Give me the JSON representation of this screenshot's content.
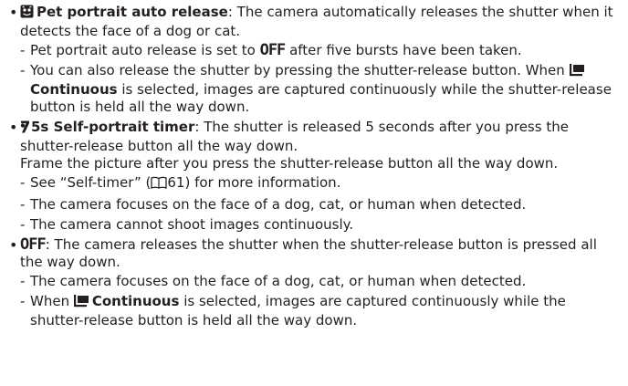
{
  "items": [
    {
      "icon": "pet-portrait-icon",
      "term": "Pet portrait auto release",
      "desc": ": The camera automatically releases the shutter when it detects the face of a dog or cat.",
      "notes": [
        {
          "before": "Pet portrait auto release is set to ",
          "off_label": "OFF",
          "after": " after five bursts have been taken."
        },
        {
          "before": "You can also release the shutter by pressing the shutter-release button. When ",
          "icon": "continuous-shooting-icon",
          "bold": "Continuous",
          "after": " is selected, images are captured continuously while the shutter-release button is held all the way down."
        }
      ]
    },
    {
      "icon": "self-portrait-timer-icon",
      "term": "5s Self-portrait timer",
      "desc": ": The shutter is released 5 seconds after you press the shutter-release button all the way down.",
      "desc2": "Frame the picture after you press the shutter-release button all the way down.",
      "notes": [
        {
          "before": "See “Self-timer” (",
          "icon": "book-page-reference-icon",
          "page": "61",
          "after": ") for more information."
        },
        {
          "text": "The camera focuses on the face of a dog, cat, or human when detected."
        },
        {
          "text": "The camera cannot shoot images continuously."
        }
      ]
    },
    {
      "off_label": "OFF",
      "desc": ": The camera releases the shutter when the shutter-release button is pressed all the way down.",
      "notes": [
        {
          "text": "The camera focuses on the face of a dog, cat, or human when detected."
        },
        {
          "before": "When ",
          "icon": "continuous-shooting-icon",
          "bold": "Continuous",
          "after": " is selected, images are captured continuously while the shutter-release button is held all the way down."
        }
      ]
    }
  ]
}
